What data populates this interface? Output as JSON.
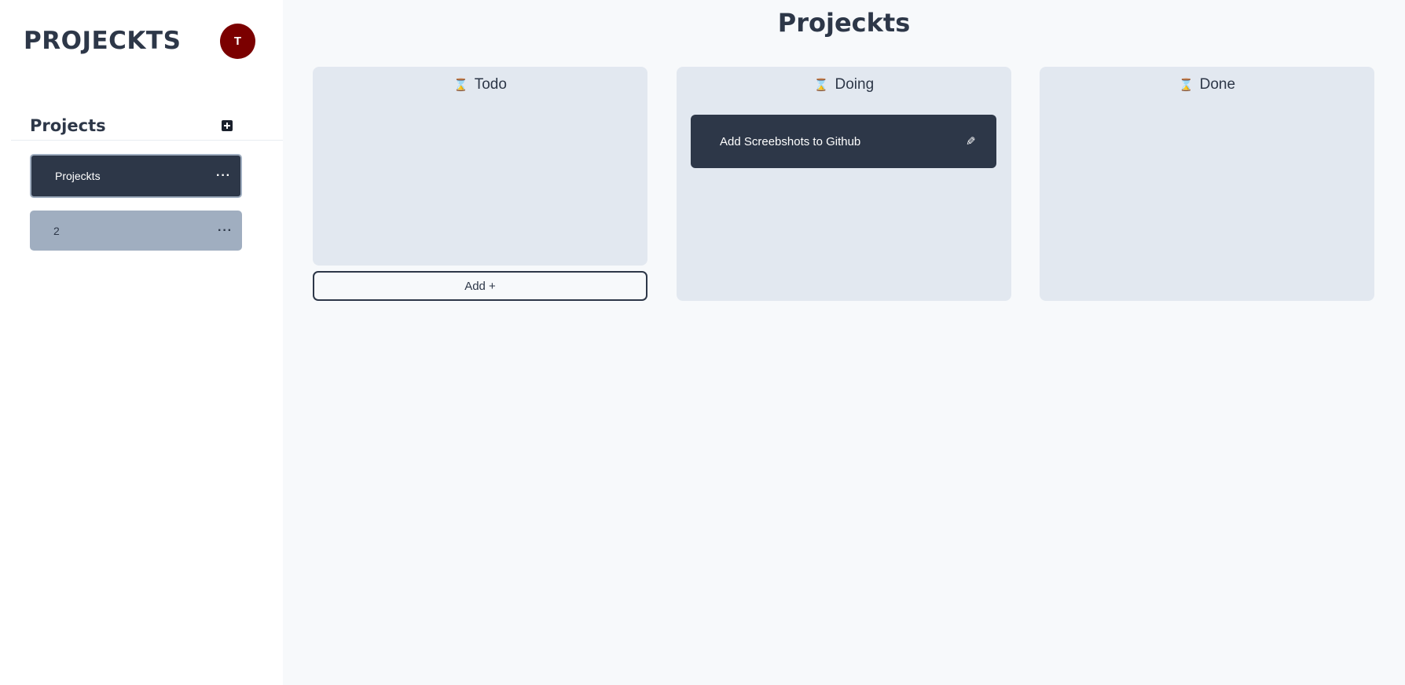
{
  "sidebar": {
    "brand": "PROJECKTS",
    "avatar_initial": "T",
    "projects_title": "Projects",
    "add_project_icon": "plus-square-icon",
    "items": [
      {
        "label": "Projeckts",
        "menu": "···",
        "active": true
      },
      {
        "label": "2",
        "menu": "···",
        "active": false
      }
    ]
  },
  "main": {
    "title": "Projeckts",
    "columns": [
      {
        "icon": "⌛",
        "title": "Todo",
        "add_label": "Add +"
      },
      {
        "icon": "⌛",
        "title": "Doing",
        "cards": [
          {
            "title": "Add Screebshots to Github",
            "edit_icon": "✎"
          }
        ]
      },
      {
        "icon": "⌛",
        "title": "Done"
      }
    ]
  },
  "colors": {
    "dark": "#2d3748",
    "column_bg": "#e2e8f0",
    "inactive_item": "#a0aec0",
    "avatar": "#7b0000",
    "page_bg": "#f7f9fb"
  }
}
